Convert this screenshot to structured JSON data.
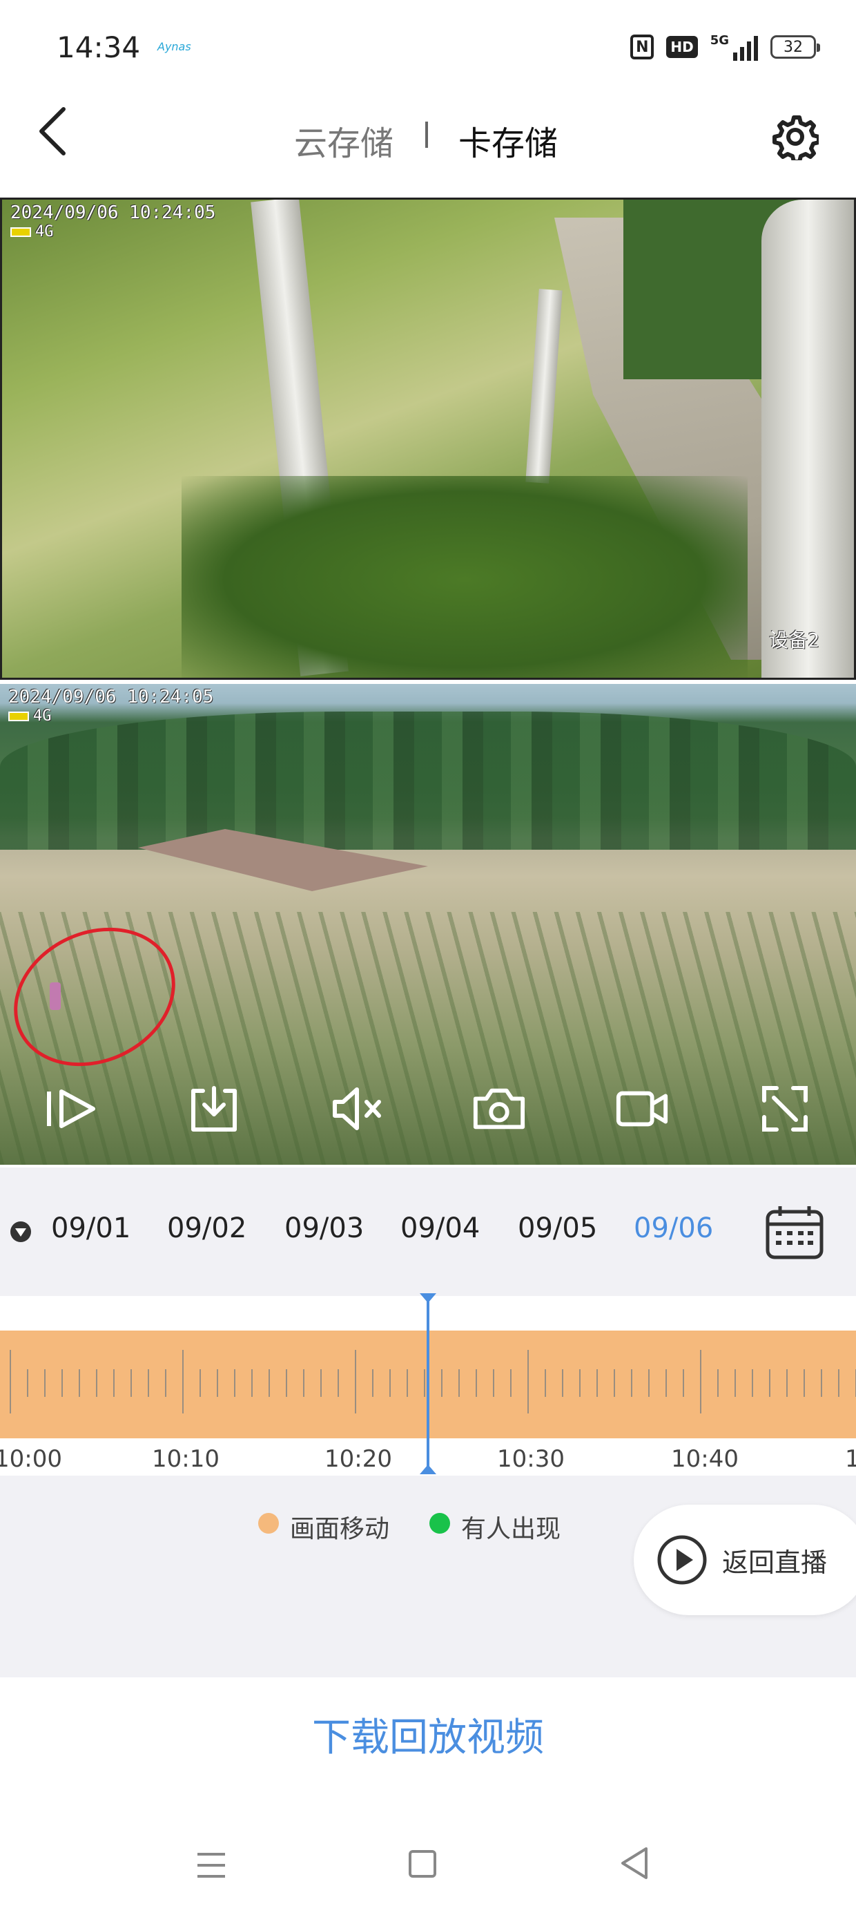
{
  "status_bar": {
    "time": "14:34",
    "app_icon_label": "Aynas",
    "nfc_icon": "nfc-icon",
    "hd_label": "HD",
    "network_label": "5G",
    "battery_level": "32"
  },
  "header": {
    "tab_cloud": "云存储",
    "tab_card": "卡存储",
    "active_tab": "卡存储"
  },
  "camera1": {
    "osd_datetime": "2024/09/06 10:24:05",
    "osd_network": "4G",
    "osd_label": "设备2"
  },
  "camera2": {
    "osd_datetime": "2024/09/06 10:24:05",
    "osd_network": "4G"
  },
  "controls": [
    "play-icon",
    "download-icon",
    "mute-icon",
    "snapshot-icon",
    "record-icon",
    "fullscreen-icon"
  ],
  "dates": {
    "items": [
      "09/01",
      "09/02",
      "09/03",
      "09/04",
      "09/05",
      "09/06"
    ],
    "selected": "09/06"
  },
  "timeline": {
    "labels": [
      "10:00",
      "10:10",
      "10:20",
      "10:30",
      "10:40"
    ],
    "band_color": "#f5b97c",
    "accent_color": "#4a8ee0"
  },
  "legend": {
    "motion_label": "画面移动",
    "motion_color": "#f5b97c",
    "person_label": "有人出现",
    "person_color": "#19c24a"
  },
  "return_live_label": "返回直播",
  "download_label": "下载回放视频"
}
